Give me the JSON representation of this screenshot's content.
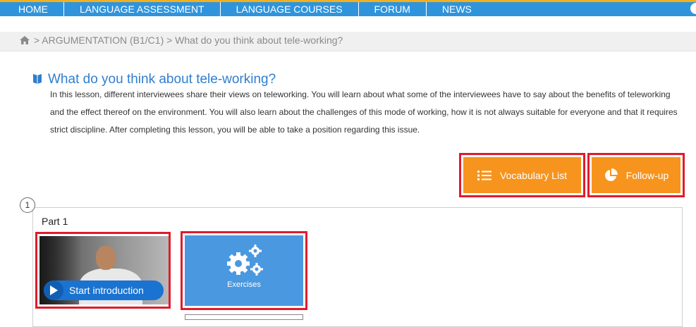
{
  "nav": {
    "items": [
      "HOME",
      "LANGUAGE ASSESSMENT",
      "LANGUAGE COURSES",
      "FORUM",
      "NEWS"
    ]
  },
  "breadcrumb": {
    "text": "> ARGUMENTATION (B1/C1) > What do you think about tele-working?"
  },
  "lesson": {
    "title": "What do you think about tele-working?",
    "intro": "In this lesson, different interviewees share their views on teleworking. You will learn about what some of the interviewees have to say about the benefits of teleworking and the effect thereof on the environment. You will also learn about the challenges of this mode of working, how it is not always suitable for everyone and that it requires strict discipline. After completing this lesson, you will be able to take a position regarding this issue."
  },
  "actions": {
    "vocabulary_label": "Vocabulary List",
    "followup_label": "Follow-up"
  },
  "part": {
    "number": "1",
    "label": "Part 1",
    "start_label": "Start introduction",
    "exercises_label": "Exercises",
    "exercises_progress": 0
  },
  "colors": {
    "nav_bg": "#2f94dc",
    "accent_orange": "#f7941d",
    "highlight_red": "#e01b2c",
    "title_blue": "#2f7fd0"
  },
  "icons": [
    "home-icon",
    "book-icon",
    "list-icon",
    "pie-chart-icon",
    "play-icon",
    "gears-icon",
    "user-circle-icon"
  ]
}
